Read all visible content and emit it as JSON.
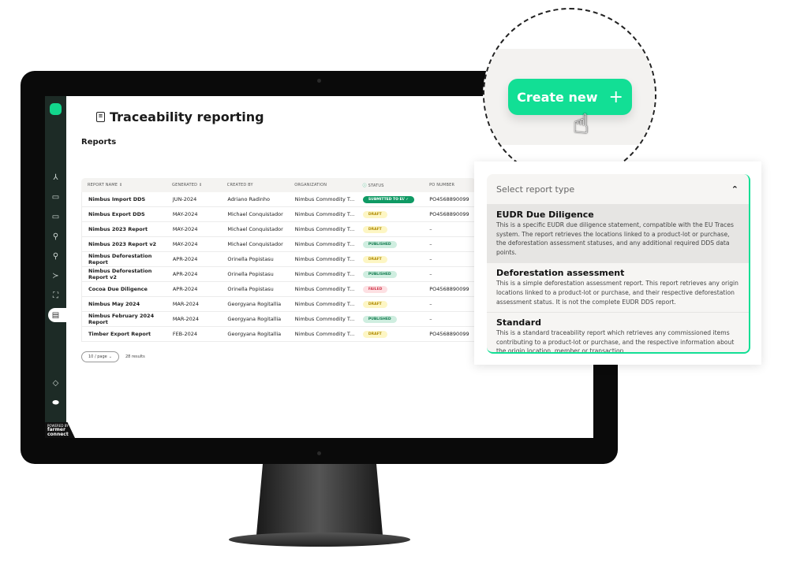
{
  "app": {
    "title": "Traceability reporting",
    "section": "Reports",
    "powered_by": "POWERED BY",
    "brand": "farmer connect"
  },
  "sidebar": {
    "icons": [
      "network-icon",
      "folder-settings-icon",
      "folder-share-icon",
      "location-pin-icon",
      "location-pin-alt-icon",
      "branch-icon",
      "scan-icon",
      "report-icon"
    ],
    "bottom_icons": [
      "help-icon",
      "user-badge-icon"
    ]
  },
  "table": {
    "headers": [
      "REPORT NAME",
      "GENERATED",
      "CREATED BY",
      "ORGANIZATION",
      "STATUS",
      "PO NUMBER"
    ],
    "rows": [
      {
        "name": "Nimbus Import DDS",
        "generated": "JUN-2024",
        "created_by": "Adriano Radinho",
        "org": "Nimbus Commodity T...",
        "status": "SUBMITTED TO EU",
        "status_kind": "sub",
        "po": "PO4568890099"
      },
      {
        "name": "Nimbus Export DDS",
        "generated": "MAY-2024",
        "created_by": "Michael Conquistador",
        "org": "Nimbus Commodity T...",
        "status": "DRAFT",
        "status_kind": "draft",
        "po": "PO4568890099"
      },
      {
        "name": "Nimbus 2023 Report",
        "generated": "MAY-2024",
        "created_by": "Michael Conquistador",
        "org": "Nimbus Commodity T...",
        "status": "DRAFT",
        "status_kind": "draft",
        "po": "–"
      },
      {
        "name": "Nimbus 2023 Report v2",
        "generated": "MAY-2024",
        "created_by": "Michael Conquistador",
        "org": "Nimbus Commodity T...",
        "status": "PUBLISHED",
        "status_kind": "pub",
        "po": "–"
      },
      {
        "name": "Nimbus Deforestation Report",
        "generated": "APR-2024",
        "created_by": "Orinella Popistasu",
        "org": "Nimbus Commodity T...",
        "status": "DRAFT",
        "status_kind": "draft",
        "po": "–"
      },
      {
        "name": "Nimbus Deforestation Report v2",
        "generated": "APR-2024",
        "created_by": "Orinella Popistasu",
        "org": "Nimbus Commodity T...",
        "status": "PUBLISHED",
        "status_kind": "pub",
        "po": "–"
      },
      {
        "name": "Cocoa Due Diligence",
        "generated": "APR-2024",
        "created_by": "Orinella Popistasu",
        "org": "Nimbus Commodity T...",
        "status": "FAILED",
        "status_kind": "fail",
        "po": "PO4568890099"
      },
      {
        "name": "Nimbus May 2024",
        "generated": "MAR-2024",
        "created_by": "Georgyana Rogitallia",
        "org": "Nimbus Commodity T...",
        "status": "DRAFT",
        "status_kind": "draft",
        "po": "–"
      },
      {
        "name": "Nimbus February 2024 Report",
        "generated": "MAR-2024",
        "created_by": "Georgyana Rogitallia",
        "org": "Nimbus Commodity T...",
        "status": "PUBLISHED",
        "status_kind": "pub",
        "po": "–"
      },
      {
        "name": "Timber Export Report",
        "generated": "FEB-2024",
        "created_by": "Georgyana Rogitallia",
        "org": "Nimbus Commodity T...",
        "status": "DRAFT",
        "status_kind": "draft",
        "po": "PO4568890099"
      }
    ]
  },
  "pager": {
    "per_page": "10 / page",
    "results": "28 results"
  },
  "create_button": {
    "label": "Create new",
    "icon": "plus-icon"
  },
  "dropdown": {
    "placeholder": "Select report type",
    "options": [
      {
        "title": "EUDR Due Diligence",
        "desc": "This is a specific EUDR due diligence statement, compatible with the EU Traces system. The report retrieves the locations linked to a product-lot or purchase, the deforestation assessment statuses, and any additional required DDS data points."
      },
      {
        "title": "Deforestation assessment",
        "desc": "This is a simple deforestation assessment report. This report retrieves any origin locations linked to a product-lot or purchase, and their respective deforestation assessment status. It is not the complete EUDR DDS report."
      },
      {
        "title": "Standard",
        "desc": "This is a standard traceability report which retrieves any commissioned items contributing to a product-lot or purchase, and the respective information about the origin location, member or transaction."
      }
    ]
  },
  "colors": {
    "accent": "#12df95",
    "sidebar": "#1d2b26",
    "submitted": "#0f9a64"
  }
}
